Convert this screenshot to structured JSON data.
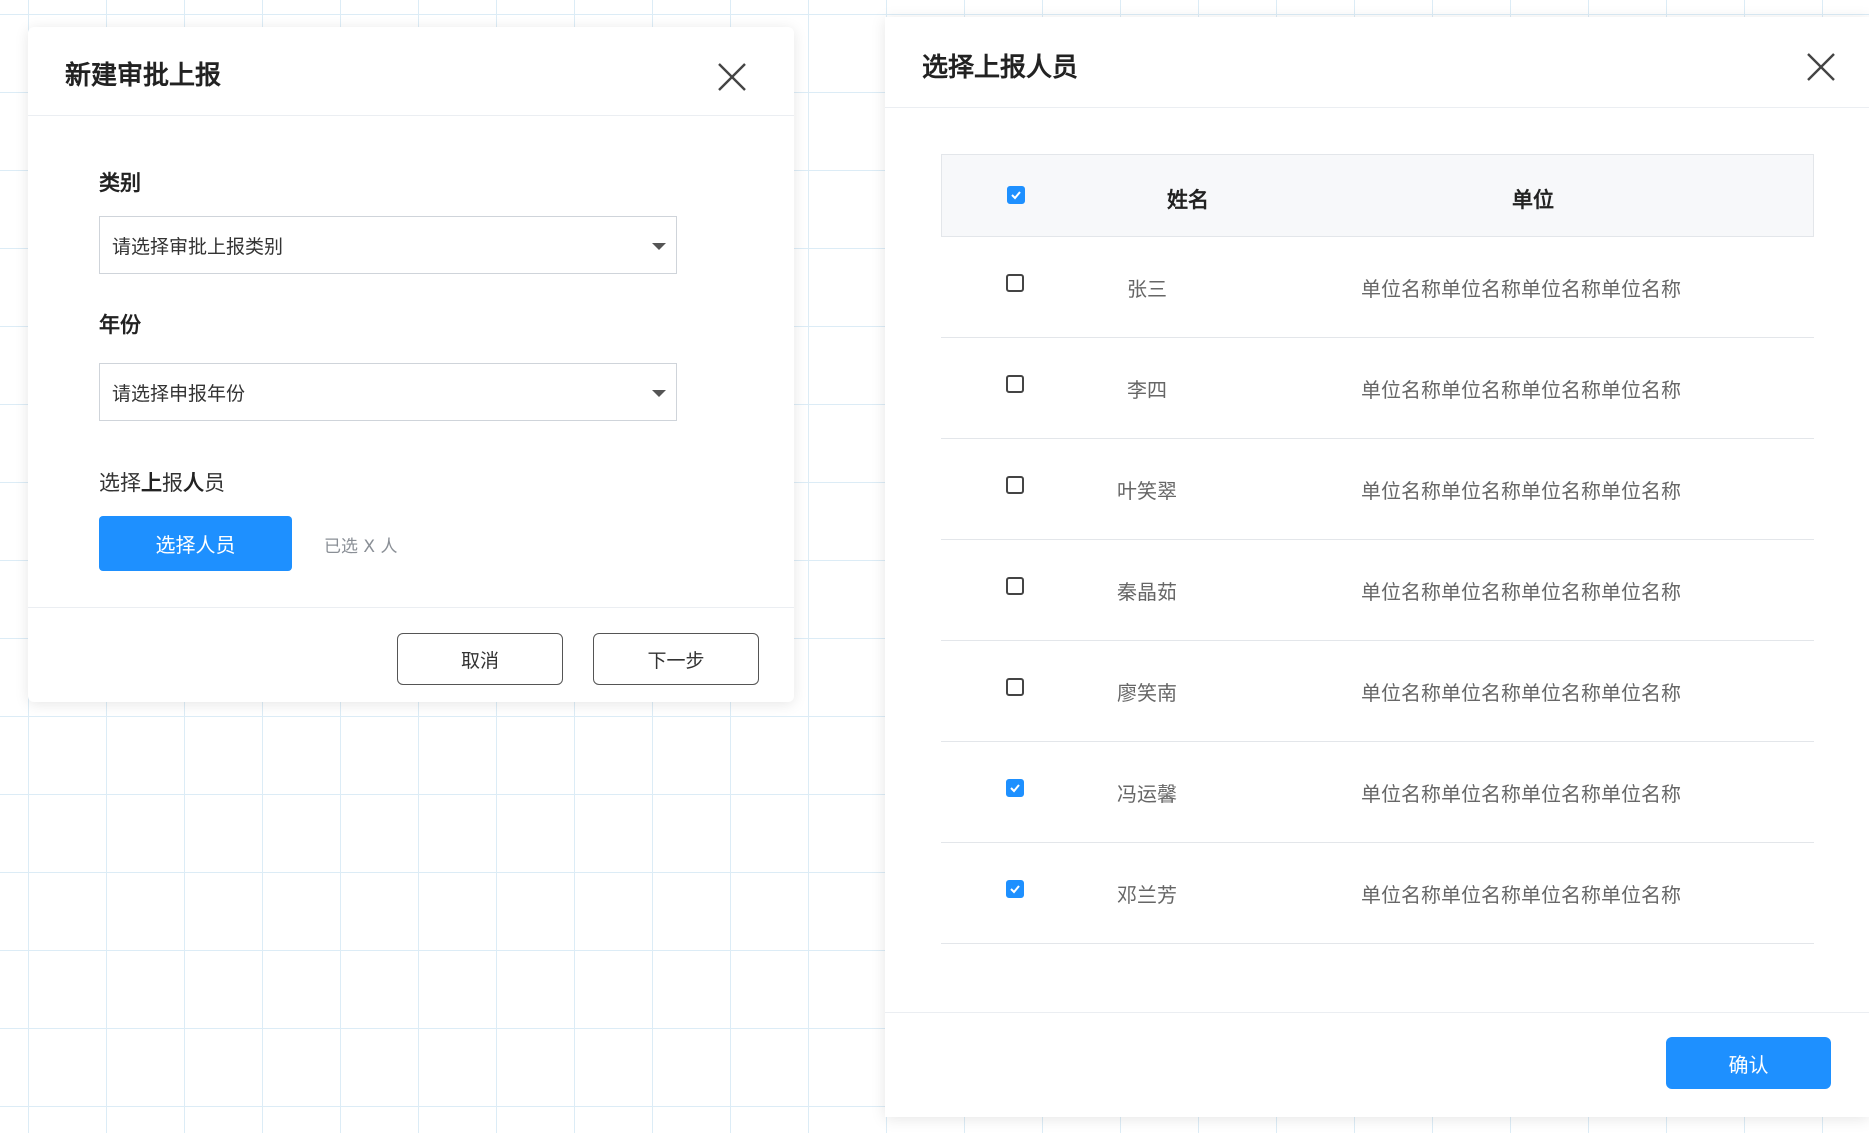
{
  "create_dialog": {
    "title": "新建审批上报",
    "category_label": "类别",
    "category_placeholder": "请选择审批上报类别",
    "year_label": "年份",
    "year_placeholder": "请选择申报年份",
    "people_label_part1": "选择",
    "people_label_part2": "上",
    "people_label_part3": "报",
    "people_label_part4": "人",
    "people_label_part5": "员",
    "select_people_button": "选择人员",
    "selected_count_text": "已选 X 人",
    "cancel_button": "取消",
    "next_button": "下一步"
  },
  "select_dialog": {
    "title": "选择上报人员",
    "header_checked": true,
    "columns": {
      "name": "姓名",
      "unit": "单位"
    },
    "rows": [
      {
        "name": "张三",
        "unit": "单位名称单位名称单位名称单位名称",
        "checked": false
      },
      {
        "name": "李四",
        "unit": "单位名称单位名称单位名称单位名称",
        "checked": false
      },
      {
        "name": "叶笑翠",
        "unit": "单位名称单位名称单位名称单位名称",
        "checked": false
      },
      {
        "name": "秦晶茹",
        "unit": "单位名称单位名称单位名称单位名称",
        "checked": false
      },
      {
        "name": "廖笑南",
        "unit": "单位名称单位名称单位名称单位名称",
        "checked": false
      },
      {
        "name": "冯运馨",
        "unit": "单位名称单位名称单位名称单位名称",
        "checked": true
      },
      {
        "name": "邓兰芳",
        "unit": "单位名称单位名称单位名称单位名称",
        "checked": true
      }
    ],
    "confirm_button": "确认"
  },
  "colors": {
    "primary": "#1e90ff",
    "grid_line": "#dcecf6"
  }
}
